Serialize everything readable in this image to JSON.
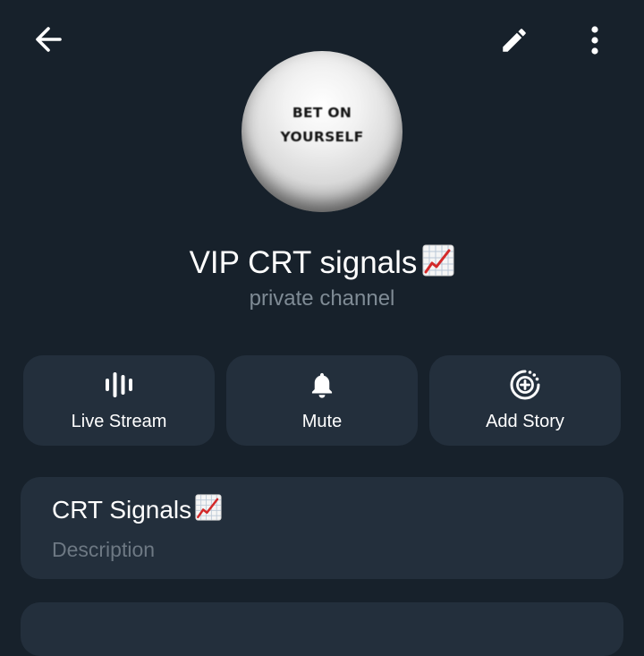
{
  "header": {
    "back_icon": "arrow-left-icon",
    "edit_icon": "pencil-icon",
    "more_icon": "more-vertical-icon"
  },
  "profile": {
    "avatar_text_line1": "BET ON",
    "avatar_text_line2": "YOURSELF",
    "title": "VIP CRT signals",
    "title_emoji": "chart-increasing-emoji",
    "subtitle": "private channel"
  },
  "actions": [
    {
      "label": "Live Stream",
      "icon": "live-stream-icon"
    },
    {
      "label": "Mute",
      "icon": "bell-icon"
    },
    {
      "label": "Add Story",
      "icon": "add-story-icon"
    }
  ],
  "info": {
    "name": "CRT Signals",
    "name_emoji": "chart-increasing-emoji",
    "description_label": "Description"
  },
  "colors": {
    "background": "#17212b",
    "card": "#232f3c",
    "text_primary": "#ffffff",
    "text_secondary": "#7f8b95"
  }
}
